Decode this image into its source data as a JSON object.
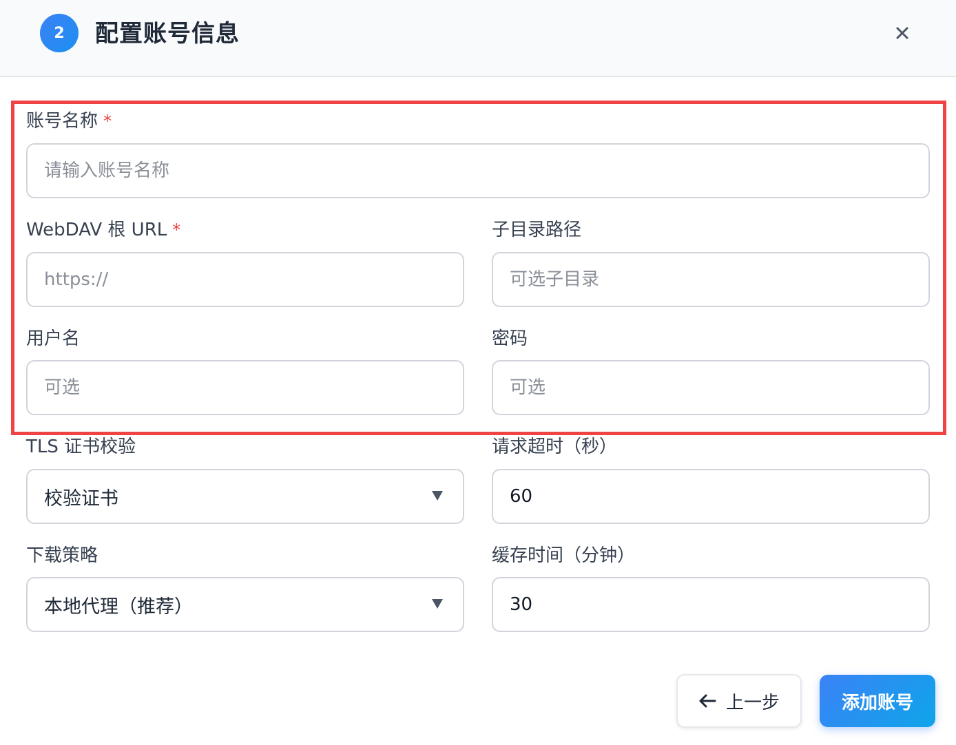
{
  "dialog": {
    "step_number": "2",
    "title": "配置账号信息"
  },
  "form": {
    "account_name": {
      "label": "账号名称",
      "required_mark": "*",
      "placeholder": "请输入账号名称",
      "value": ""
    },
    "webdav_url": {
      "label": "WebDAV 根 URL",
      "required_mark": "*",
      "placeholder": "https://",
      "value": ""
    },
    "subdir": {
      "label": "子目录路径",
      "placeholder": "可选子目录",
      "value": ""
    },
    "username": {
      "label": "用户名",
      "placeholder": "可选",
      "value": ""
    },
    "password": {
      "label": "密码",
      "placeholder": "可选",
      "value": ""
    },
    "tls": {
      "label": "TLS 证书校验",
      "selected": "校验证书"
    },
    "timeout": {
      "label": "请求超时（秒）",
      "value": "60"
    },
    "download": {
      "label": "下载策略",
      "selected": "本地代理（推荐）"
    },
    "cache": {
      "label": "缓存时间（分钟）",
      "value": "30"
    }
  },
  "buttons": {
    "back_label": "上一步",
    "submit_label": "添加账号"
  },
  "icons": {
    "close": "close-icon",
    "back": "arrow-left-icon",
    "dropdown": "caret-down-icon"
  },
  "colors": {
    "accent": "#3b82f6",
    "required": "#ef4444",
    "highlight_border": "#ef4444"
  }
}
